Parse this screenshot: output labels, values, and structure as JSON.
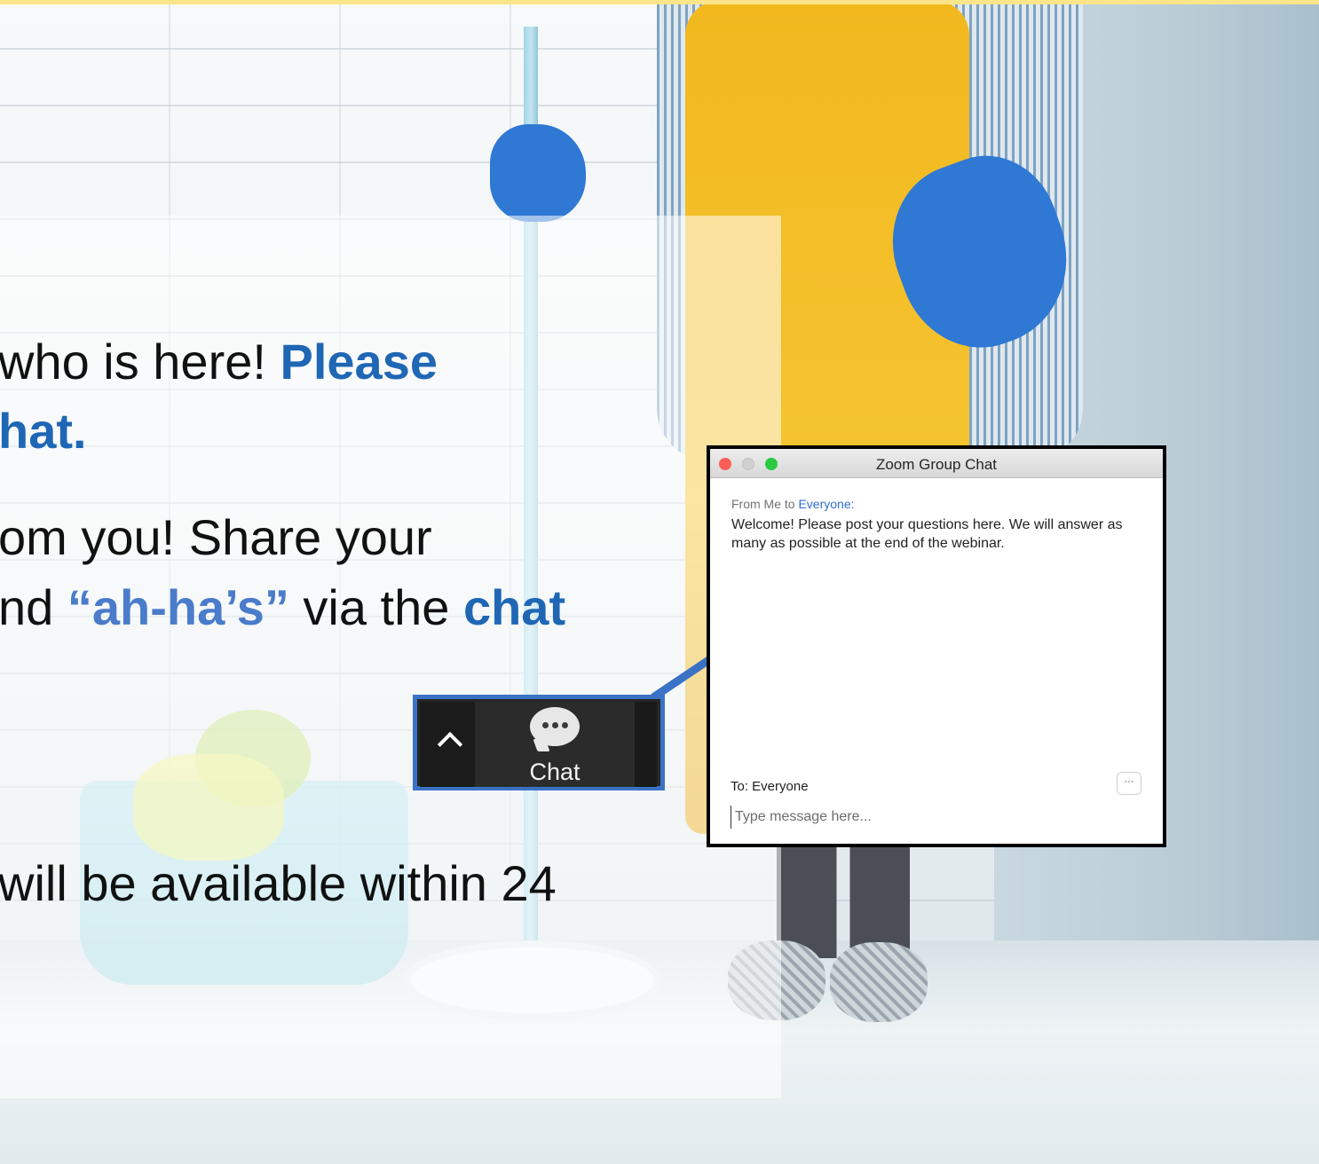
{
  "slide": {
    "line1_plain": "who is here! ",
    "line1_highlight": "Please",
    "line2_highlight": "hat.",
    "line3": "om you! Share your",
    "line4_prefix": "nd ",
    "line4_quote": "“ah-ha’s”",
    "line4_mid": " via the ",
    "line4_chat": "chat",
    "line5": "will be available within 24"
  },
  "chat_button": {
    "label": "Chat",
    "caret_icon": "chevron-up-icon",
    "bubble_icon": "chat-bubble-icon"
  },
  "zoom_window": {
    "title": "Zoom Group Chat",
    "message": {
      "from_prefix": "From Me to ",
      "recipient": "Everyone:",
      "body": "Welcome!  Please post your questions here. We will answer as many as possible at the end of the webinar."
    },
    "to_label": "To: Everyone",
    "more_label": "···",
    "input_placeholder": "Type message here..."
  },
  "colors": {
    "highlight_blue": "#1f67b5",
    "quote_blue": "#4a7ccb",
    "arrow_blue": "#3a72c6",
    "mac_red": "#fd5f57",
    "mac_green": "#2ac940"
  }
}
